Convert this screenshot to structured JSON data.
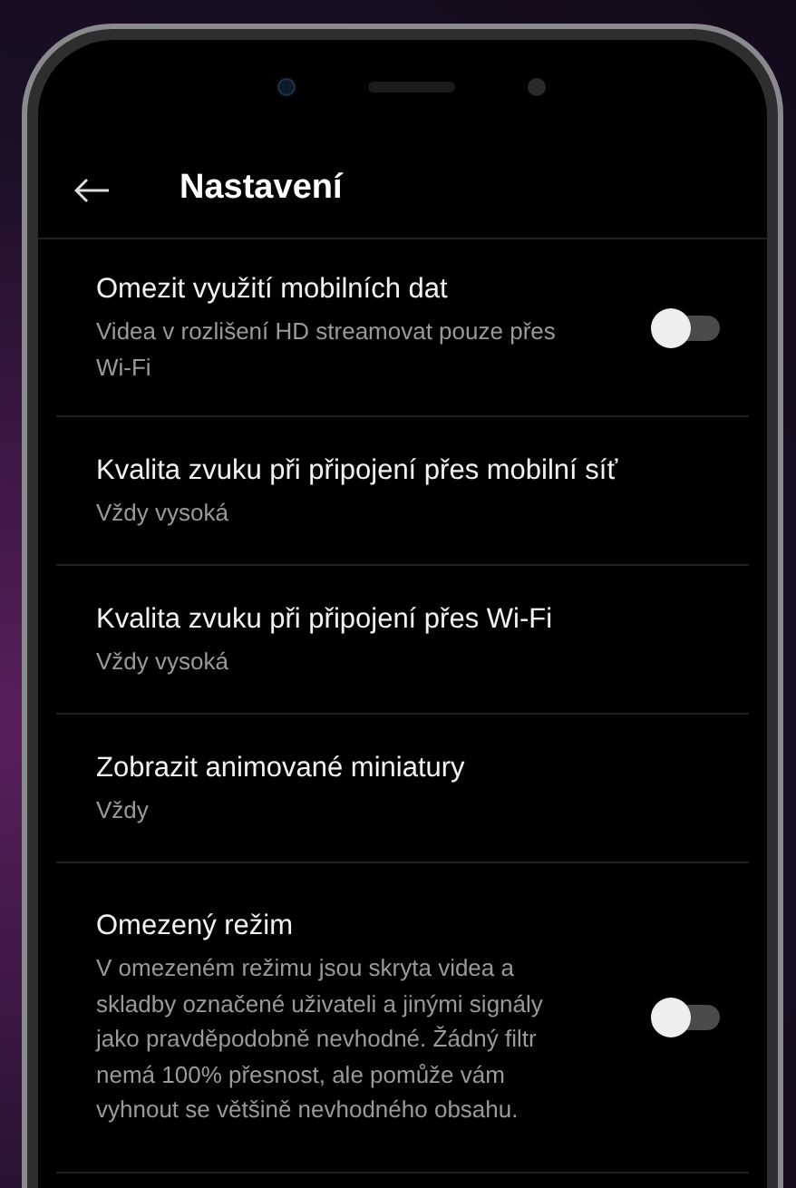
{
  "header": {
    "title": "Nastavení"
  },
  "settings": [
    {
      "kind": "toggle",
      "title": "Omezit využití mobilních dat",
      "description": "Videa v rozlišení HD streamovat pouze přes Wi-Fi",
      "on": false
    },
    {
      "kind": "choice",
      "title": "Kvalita zvuku při připojení přes mobilní síť",
      "description": "Vždy vysoká"
    },
    {
      "kind": "choice",
      "title": "Kvalita zvuku při připojení přes Wi-Fi",
      "description": "Vždy vysoká"
    },
    {
      "kind": "choice",
      "title": "Zobrazit animované miniatury",
      "description": "Vždy"
    },
    {
      "kind": "toggle",
      "title": "Omezený režim",
      "description": "V omezeném režimu jsou skryta videa a skladby označené uživateli a jinými signály jako pravděpodobně nevhodné. Žádný filtr nemá 100% přesnost, ale pomůže vám vyhnout se většině nevhodného obsahu.",
      "on": false
    }
  ]
}
